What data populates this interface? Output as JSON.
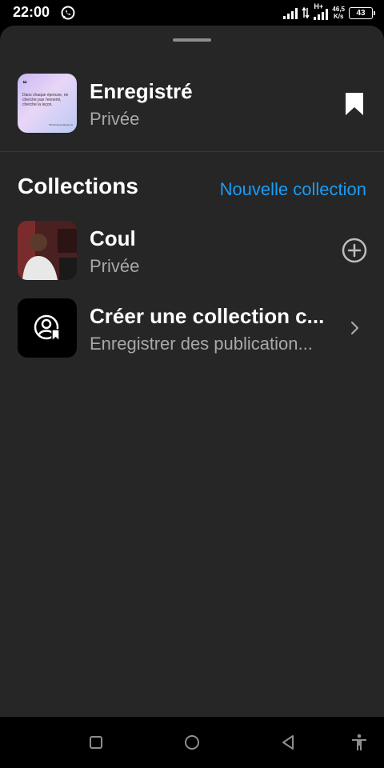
{
  "status_bar": {
    "time": "22:00",
    "network_type": "H+",
    "speed_value": "46,5",
    "speed_unit": "K/s",
    "battery": "43"
  },
  "saved": {
    "title": "Enregistré",
    "subtitle": "Privée",
    "thumbnail_quote": "Dans chaque épreuve, ne cherche pas l'ennemi, cherche la leçon.",
    "thumbnail_author": "#TheKramas Reasons"
  },
  "collections": {
    "title": "Collections",
    "new_label": "Nouvelle collection",
    "accent_color": "#1a9cf5",
    "items": [
      {
        "title": "Coul",
        "subtitle": "Privée",
        "action_icon": "plus-circle-icon"
      },
      {
        "title": "Créer une collection c...",
        "subtitle": "Enregistrer des publication...",
        "action_icon": "chevron-right-icon"
      }
    ]
  },
  "colors": {
    "sheet_background": "#262626",
    "secondary_text": "#a8a8a8"
  }
}
